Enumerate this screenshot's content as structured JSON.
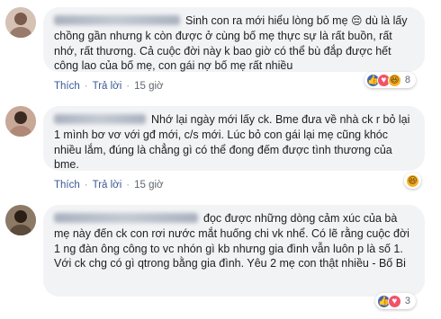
{
  "colors": {
    "bubble_bg": "#f2f3f5",
    "action_text": "#606770",
    "like_blue": "#4267b2",
    "love_red": "#f25268",
    "haha_yellow": "#f7b125"
  },
  "actions": {
    "like": "Thích",
    "reply": "Trả lời",
    "separator": "·"
  },
  "comments": [
    {
      "text": "Sinh con ra mới hiểu lòng bố mẹ",
      "emoji": "😔",
      "text_after": " dù là lấy chồng gần nhưng k còn được ở cùng bố mẹ thực sự là rất buồn, rất nhớ, rất thương. Cả cuộc đời này k bao giờ có thể bù đắp được hết công lao của bố mẹ, con gái nợ bố mẹ rất nhiều",
      "time": "15 giờ",
      "reactions": [
        "like-icon",
        "love-icon",
        "haha-icon"
      ],
      "reaction_count": "8"
    },
    {
      "text": "Nhớ lại ngày mới lấy ck. Bme đưa về nhà ck r bỏ lại 1 mình bơ vơ với gđ mới, c/s mới. Lúc bỏ con gái lại mẹ cũng khóc nhiều lắm, đúng là chẳng gì có thể đong đếm được tình thương của bme.",
      "time": "15 giờ",
      "reactions": [
        "haha-icon"
      ],
      "reaction_count": ""
    },
    {
      "text": "đọc được những dòng cảm xúc của bà mẹ này đến ck con rơi nước mắt huống chi vk nhể. Có lẽ rằng cuộc đời 1 ng đàn ông công to vc nhón gì kb nhưng gia đình vẫn luôn p là số 1. Với ck chg có gì qtrong bằng gia đình. Yêu 2 mẹ con thật nhiều - Bố Bi",
      "time": "15 giờ",
      "reactions": [
        "like-icon",
        "love-icon"
      ],
      "reaction_count": "3"
    }
  ]
}
